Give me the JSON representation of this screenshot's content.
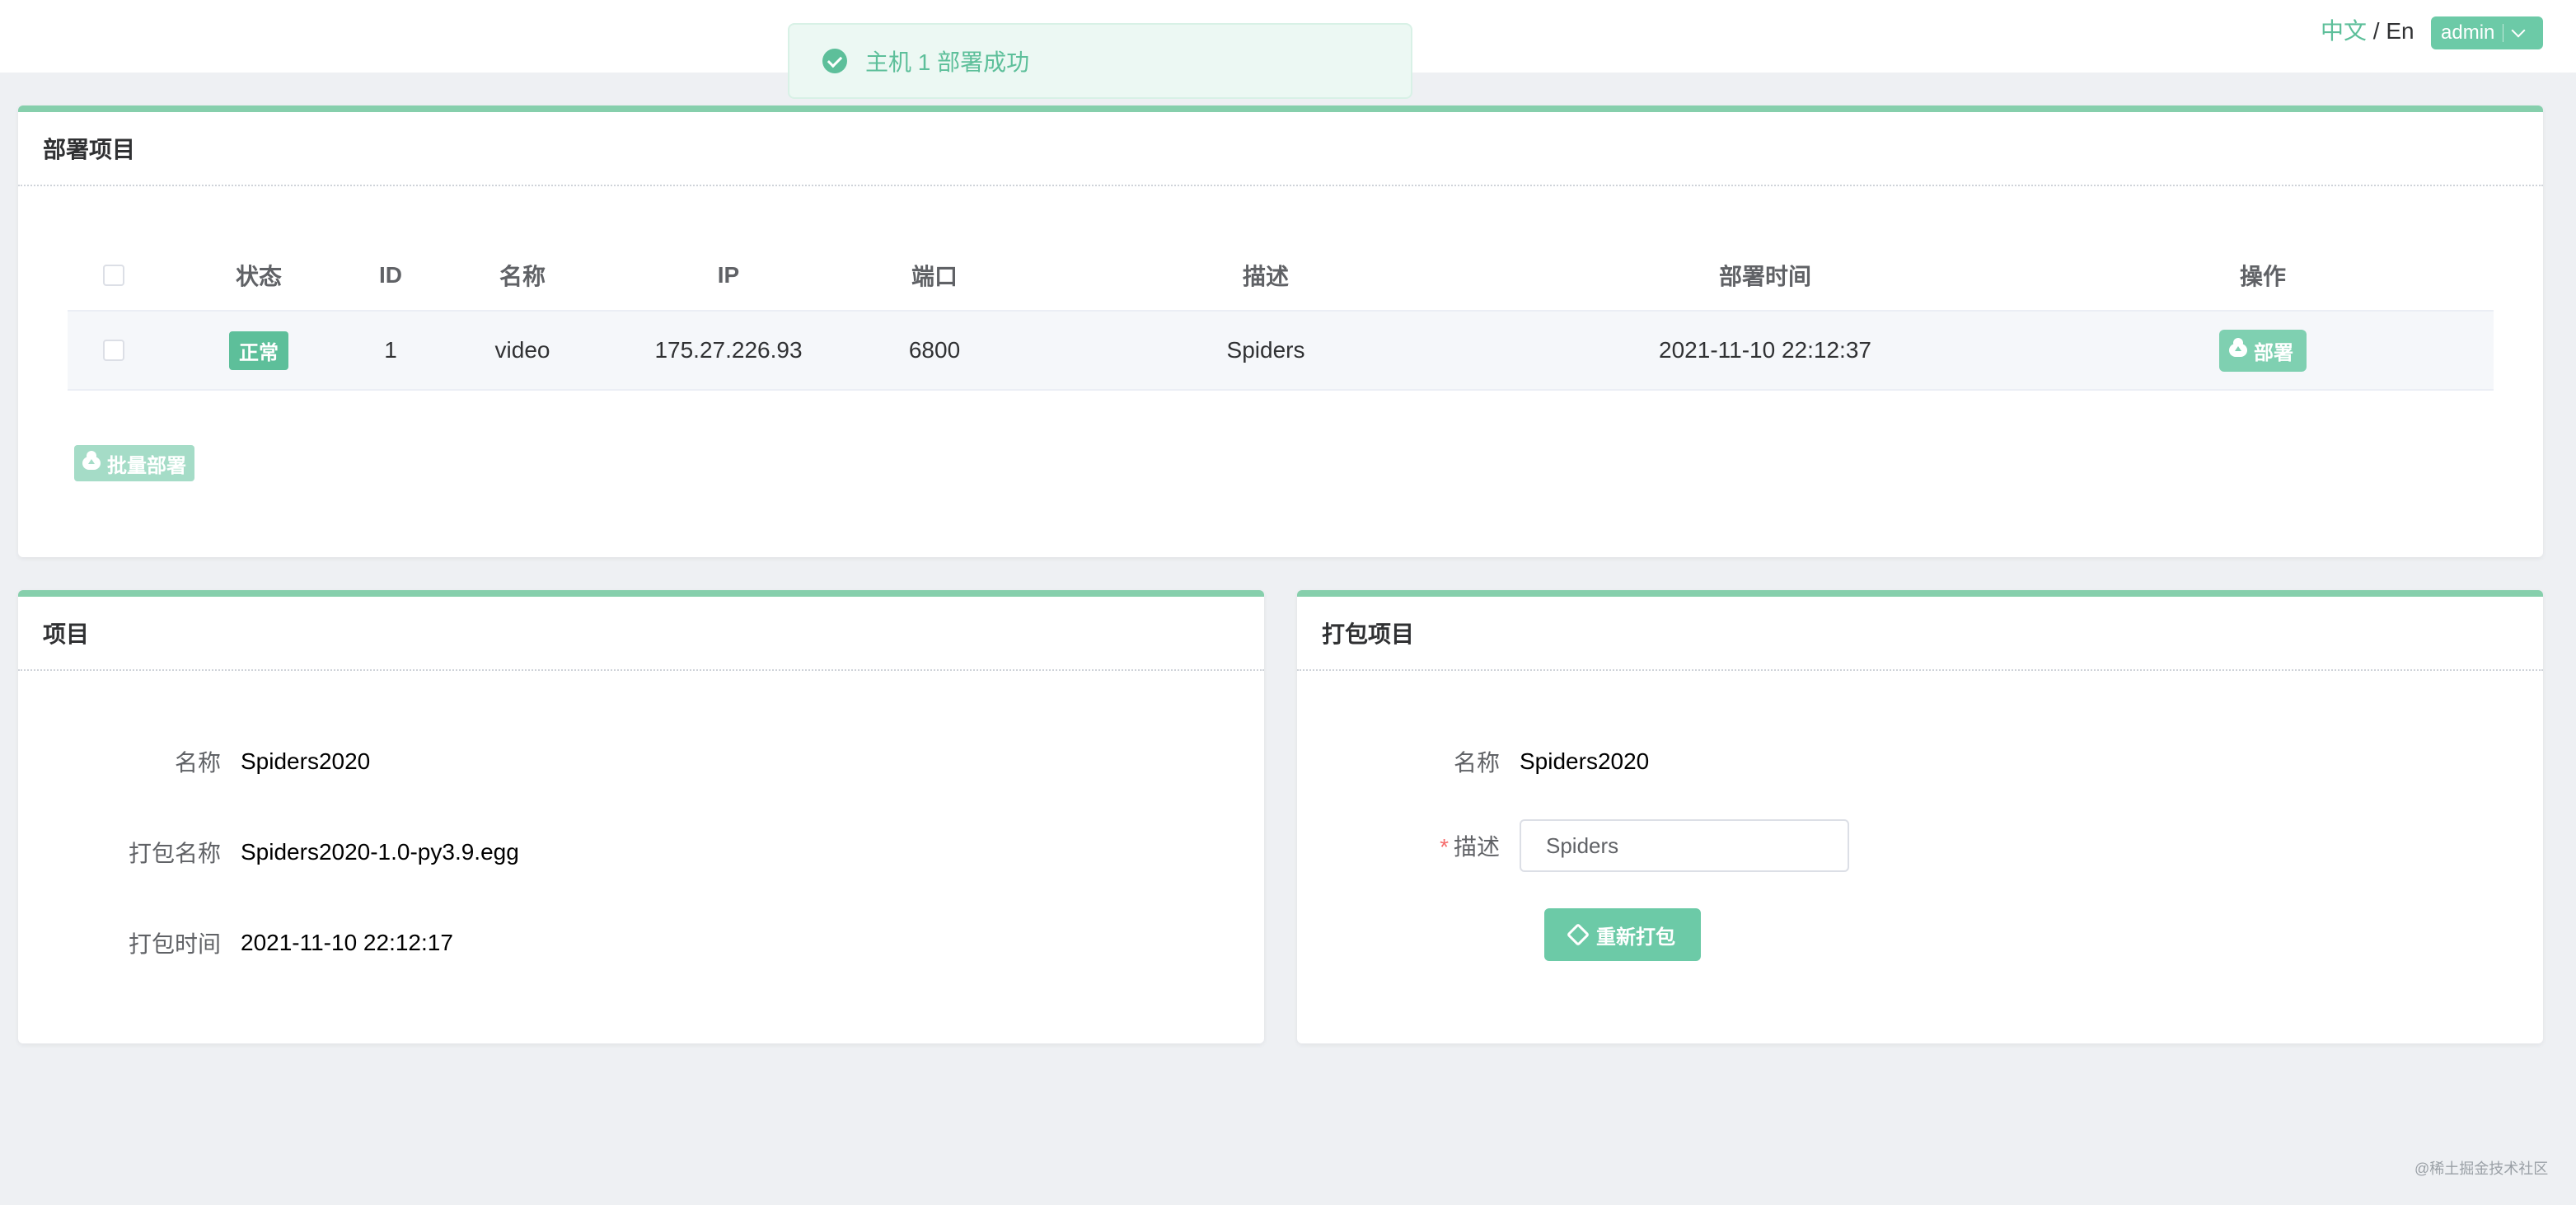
{
  "header": {
    "lang_zh": "中文",
    "lang_sep": "/",
    "lang_en": "En",
    "user": "admin"
  },
  "toast": {
    "message": "主机 1 部署成功",
    "icon": "check-circle-icon"
  },
  "deploy_panel": {
    "title": "部署项目",
    "columns": [
      "状态",
      "ID",
      "名称",
      "IP",
      "端口",
      "描述",
      "部署时间",
      "操作"
    ],
    "rows": [
      {
        "status": "正常",
        "id": "1",
        "name": "video",
        "ip": "175.27.226.93",
        "port": "6800",
        "description": "Spiders",
        "deploy_time": "2021-11-10 22:12:37",
        "action": "部署"
      }
    ],
    "batch_button": "批量部署"
  },
  "project_panel": {
    "title": "项目",
    "name_label": "名称",
    "name_value": "Spiders2020",
    "package_label": "打包名称",
    "package_value": "Spiders2020-1.0-py3.9.egg",
    "time_label": "打包时间",
    "time_value": "2021-11-10 22:12:17"
  },
  "build_panel": {
    "title": "打包项目",
    "name_label": "名称",
    "name_value": "Spiders2020",
    "required_mark": "*",
    "desc_label": "描述",
    "desc_value": "Spiders",
    "rebuild_button": "重新打包"
  },
  "watermark": "@稀土掘金技术社区",
  "colors": {
    "accent": "#5dbf9a",
    "panel_border": "#86cfac",
    "background": "#eef0f3"
  }
}
